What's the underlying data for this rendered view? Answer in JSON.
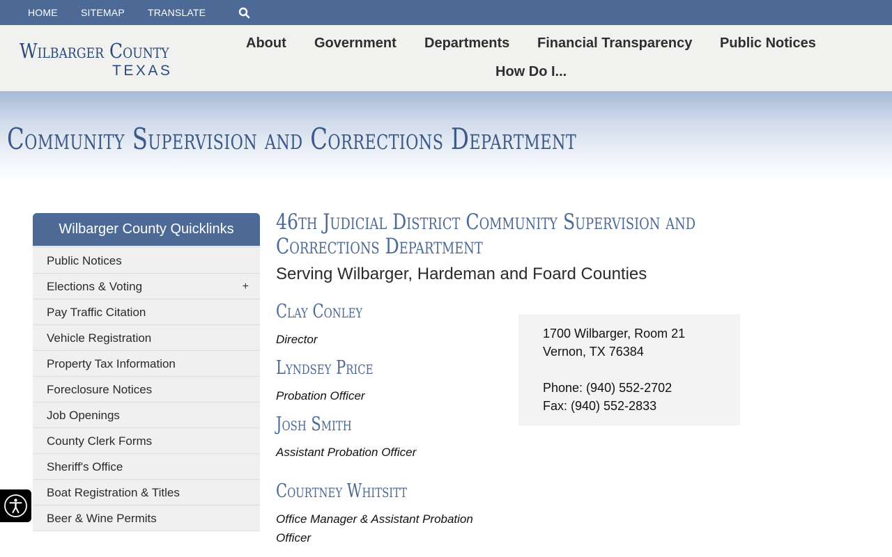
{
  "topbar": {
    "home": "HOME",
    "sitemap": "SITEMAP",
    "translate": "TRANSLATE",
    "search_icon": "search-icon"
  },
  "logo": {
    "line1": "Wilbarger County",
    "line2": "TEXAS"
  },
  "nav": {
    "about": "About",
    "government": "Government",
    "departments": "Departments",
    "financial": "Financial Transparency",
    "notices": "Public Notices",
    "howdoi": "How Do I..."
  },
  "banner": {
    "title": "Community Supervision and Corrections Department"
  },
  "sidebar": {
    "title": "Wilbarger County Quicklinks",
    "items": [
      {
        "label": "Public Notices"
      },
      {
        "label": "Elections & Voting",
        "expand": "+"
      },
      {
        "label": "Pay Traffic Citation"
      },
      {
        "label": "Vehicle Registration"
      },
      {
        "label": "Property Tax Information"
      },
      {
        "label": "Foreclosure Notices"
      },
      {
        "label": "Job Openings"
      },
      {
        "label": "County Clerk Forms"
      },
      {
        "label": "Sheriff's Office"
      },
      {
        "label": "Boat Registration & Titles"
      },
      {
        "label": "Beer & Wine Permits"
      }
    ]
  },
  "main": {
    "heading": "46th Judicial District Community Supervision and Corrections Department",
    "subtitle": "Serving Wilbarger, Hardeman and Foard Counties",
    "staff": [
      {
        "name": "Clay Conley",
        "role": "Director"
      },
      {
        "name": "Lyndsey Price",
        "role": "Probation Officer"
      },
      {
        "name": "Josh Smith",
        "role": "Assistant Probation Officer"
      },
      {
        "name": "Courtney Whitsitt",
        "role_line1": "Office Manager & Assistant Probation",
        "role_line2": "Officer"
      }
    ],
    "contact": {
      "address1": "1700 Wilbarger, Room 21",
      "address2": "Vernon, TX 76384",
      "phone": "Phone: (940) 552-2702",
      "fax": "Fax: (940) 552-2833"
    }
  },
  "a11y": {
    "icon": "accessibility-icon"
  },
  "colors": {
    "brand_blue": "#4d6a96",
    "header_bg": "#f1f1ef",
    "heading_blue": "#3c5a89"
  }
}
